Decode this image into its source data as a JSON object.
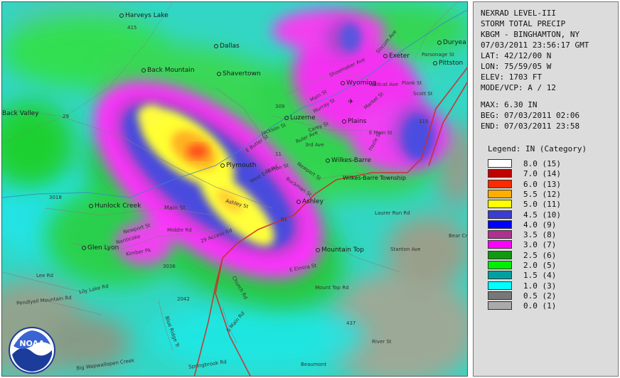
{
  "panel": {
    "lines": [
      "NEXRAD LEVEL-III",
      "STORM TOTAL PRECIP",
      "KBGM - BINGHAMTON, NY",
      "07/03/2011 23:56:17 GMT",
      "LAT: 42/12/00 N",
      "LON: 75/59/05 W",
      "ELEV: 1703 FT",
      "MODE/VCP: A / 12"
    ],
    "stats": [
      "MAX: 6.30 IN",
      "BEG: 07/03/2011 02:06",
      "END: 07/03/2011 23:58"
    ],
    "legend_title": "Legend: IN (Category)",
    "legend": [
      {
        "label": "8.0  (15)",
        "color": "#ffffff"
      },
      {
        "label": "7.0  (14)",
        "color": "#c00000"
      },
      {
        "label": "6.0  (13)",
        "color": "#ff2a00"
      },
      {
        "label": "5.5  (12)",
        "color": "#ffae00"
      },
      {
        "label": "5.0  (11)",
        "color": "#ffff00"
      },
      {
        "label": "4.5  (10)",
        "color": "#3b3bd6"
      },
      {
        "label": "4.0  (9)",
        "color": "#0000ff"
      },
      {
        "label": "3.5  (8)",
        "color": "#b03090"
      },
      {
        "label": "3.0  (7)",
        "color": "#ff00ff"
      },
      {
        "label": "2.5  (6)",
        "color": "#119911"
      },
      {
        "label": "2.0  (5)",
        "color": "#00ee00"
      },
      {
        "label": "1.5  (4)",
        "color": "#00a0a0"
      },
      {
        "label": "1.0  (3)",
        "color": "#00ffff"
      },
      {
        "label": "0.5  (2)",
        "color": "#777777"
      },
      {
        "label": "0.0  (1)",
        "color": "#aaaaaa"
      }
    ]
  },
  "map": {
    "places": [
      "Harveys Lake",
      "Dallas",
      "Shavertown",
      "Back Mountain",
      "Duryea",
      "Exeter",
      "Pittston",
      "Wyoming",
      "Luzerne",
      "Plains",
      "Plymouth",
      "Wilkes-Barre",
      "Wilkes-Barre Township",
      "Hunlock Creek",
      "Glen Lyon",
      "Ashley",
      "Mountain Top",
      "Laurer Run Rd",
      "Lee Rd",
      "Lily Lake Rd",
      "Main St",
      "Middle Rd",
      "Nanticoke",
      "Kimber Pk",
      "Newport St",
      "29 Access Rd",
      "Church Rd",
      "Springbrook Rd",
      "S Main Rd",
      "Blue Ridge Tr",
      "Pendlyell Mountain Rd",
      "Back Valley",
      "Big Wapwallopen Creek",
      "Bear Creek",
      "Shoemaker Ave",
      "Slocum Ave",
      "Parsonage St",
      "Plank St",
      "Scott St",
      "Main St",
      "Murray St",
      "Carey St",
      "Jackson St",
      "E Butler St",
      "Ruler Ave",
      "3rd Ave",
      "Market St",
      "Hazle St",
      "Wildcat Ave",
      "E Main St",
      "Buckman St",
      "West End Rd",
      "Horton St",
      "Newport St",
      "Ashley St",
      "Stanton Ave",
      "E Elmira St",
      "Mount Top Rd",
      "River St",
      "Beaumont"
    ],
    "roads": [
      "29",
      "309",
      "415",
      "437",
      "115",
      "11",
      "81",
      "2042",
      "3036",
      "3018"
    ],
    "icons": [
      "noaa-logo-icon",
      "airport-icon"
    ]
  }
}
